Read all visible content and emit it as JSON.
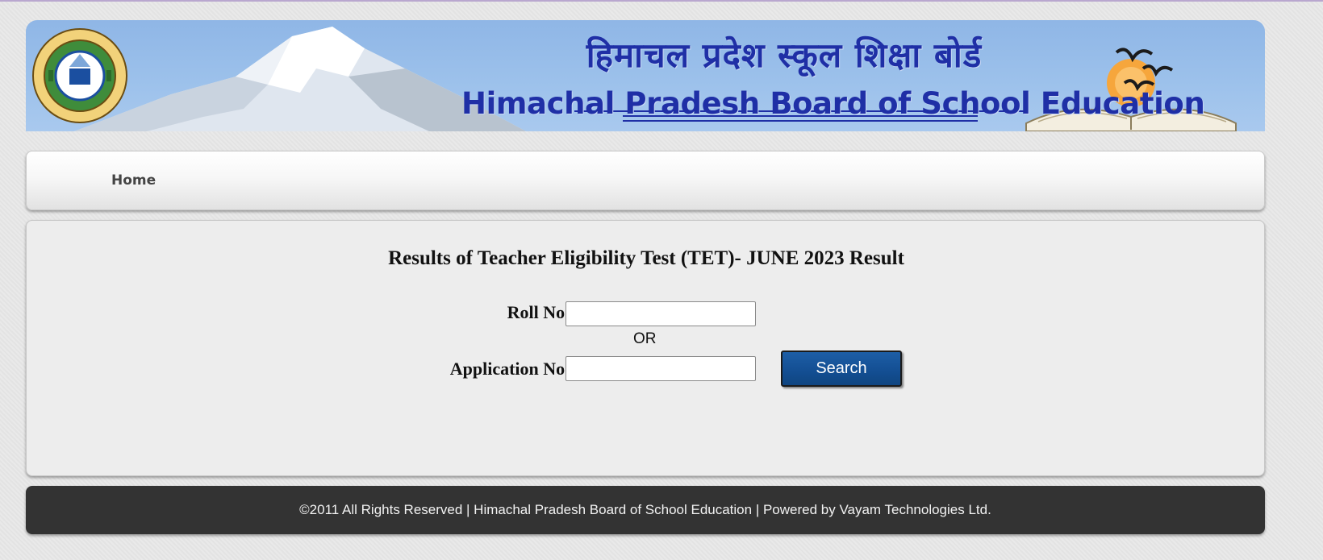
{
  "header": {
    "title_hindi": "हिमाचल प्रदेश स्कूल शिक्षा बोर्ड",
    "title_english": "Himachal Pradesh Board of School Education",
    "logo_icon": "hpbose-seal-icon",
    "colors": {
      "title": "#1f2fa6",
      "banner_sky": "#9cc1eb"
    }
  },
  "nav": {
    "items": [
      {
        "label": "Home"
      }
    ]
  },
  "main": {
    "title": "Results of Teacher Eligibility Test (TET)- JUNE 2023 Result",
    "roll_label": "Roll No :",
    "roll_value": "",
    "or_text": "OR",
    "application_label": "Application No :",
    "application_value": "",
    "search_label": "Search",
    "colors": {
      "search_button": "#134e92"
    }
  },
  "footer": {
    "text": "©2011 All Rights Reserved | Himachal Pradesh Board of School Education | Powered by Vayam Technologies Ltd.",
    "colors": {
      "background": "#333333"
    }
  }
}
